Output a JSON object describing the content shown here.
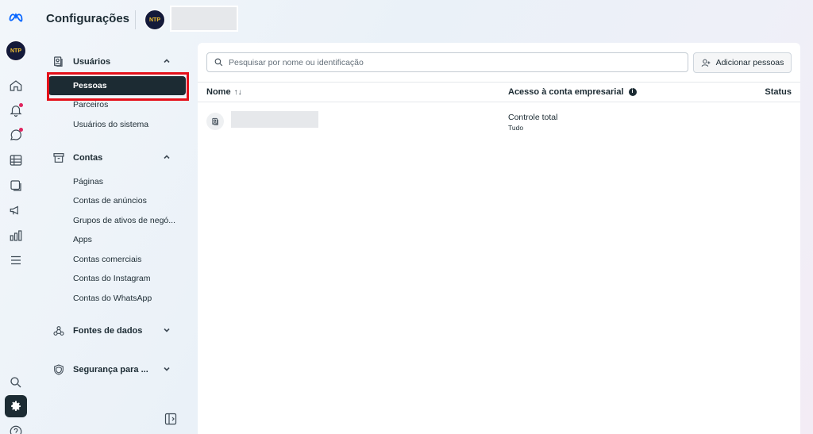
{
  "app": {
    "title": "Configurações",
    "account_avatar": "NTP"
  },
  "rail": {
    "icons": [
      "meta-logo-icon",
      "account-avatar",
      "home-icon",
      "notifications-icon",
      "messages-icon",
      "table-icon",
      "layers-icon",
      "megaphone-icon",
      "analytics-icon",
      "menu-icon",
      "search-icon",
      "gear-icon",
      "help-icon"
    ]
  },
  "sidebar": {
    "users_section": {
      "label": "Usuários",
      "items": [
        "Pessoas",
        "Parceiros",
        "Usuários do sistema"
      ]
    },
    "accounts_section": {
      "label": "Contas",
      "items": [
        "Páginas",
        "Contas de anúncios",
        "Grupos de ativos de negó...",
        "Apps",
        "Contas comerciais",
        "Contas do Instagram",
        "Contas do WhatsApp"
      ]
    },
    "data_sources_section": {
      "label": "Fontes de dados"
    },
    "security_section": {
      "label": "Segurança para ..."
    }
  },
  "main": {
    "search": {
      "placeholder": "Pesquisar por nome ou identificação"
    },
    "add_button": "Adicionar pessoas",
    "columns": {
      "name": "Nome",
      "access": "Acesso à conta empresarial",
      "status": "Status"
    },
    "rows": [
      {
        "access": "Controle total",
        "access_detail": "Tudo"
      }
    ]
  },
  "colors": {
    "accent": "#1c2b33",
    "highlight": "#e5101a",
    "notification": "#e0245e"
  }
}
